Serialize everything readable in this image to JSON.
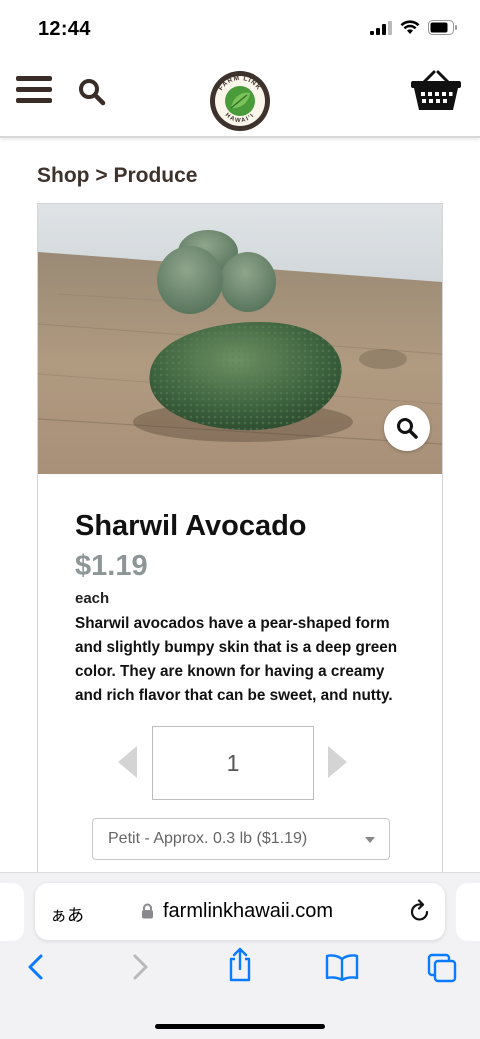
{
  "status_bar": {
    "time": "12:44"
  },
  "header": {
    "logo_text_top": "FARM LINK",
    "logo_text_bottom": "HAWAI'I"
  },
  "breadcrumb": {
    "parent": "Shop",
    "separator": " > ",
    "current": "Produce"
  },
  "product": {
    "title": "Sharwil Avocado",
    "price": "$1.19",
    "unit": "each",
    "description": "Sharwil avocados have a pear-shaped form and slightly bumpy skin that is a deep green color. They are known for having a creamy and rich flavor that can be sweet, and nutty.",
    "quantity": "1",
    "size_option": "Petit - Approx. 0.3 lb ($1.19)"
  },
  "browser": {
    "text_size_label": "ぁあ",
    "url": "farmlinkhawaii.com"
  },
  "colors": {
    "brand_dark": "#3e322c",
    "price_gray": "#8e9596",
    "ios_blue": "#0a7aff"
  }
}
